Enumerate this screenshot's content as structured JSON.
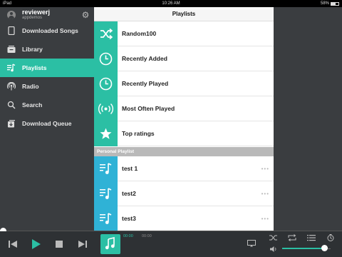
{
  "statusbar": {
    "carrier": "iPad",
    "time": "10:26 AM",
    "battery": "58%",
    "battery_level": 0.58
  },
  "user": {
    "name": "reviewerj",
    "subtitle": "appdemos"
  },
  "nav": {
    "items": [
      {
        "label": "Downloaded Songs",
        "icon": "tablet-icon",
        "active": false
      },
      {
        "label": "Library",
        "icon": "library-icon",
        "active": false
      },
      {
        "label": "Playlists",
        "icon": "playlist-icon",
        "active": true
      },
      {
        "label": "Radio",
        "icon": "radio-icon",
        "active": false
      },
      {
        "label": "Search",
        "icon": "search-icon",
        "active": false
      },
      {
        "label": "Download Queue",
        "icon": "download-queue-icon",
        "active": false
      }
    ]
  },
  "panel": {
    "title": "Playlists",
    "smart_playlists": [
      {
        "label": "Random100",
        "icon": "shuffle-icon"
      },
      {
        "label": "Recently Added",
        "icon": "clock-icon"
      },
      {
        "label": "Recently Played",
        "icon": "clock-icon"
      },
      {
        "label": "Most Often Played",
        "icon": "broadcast-icon"
      },
      {
        "label": "Top ratings",
        "icon": "star-icon"
      }
    ],
    "section_title": "Personal Playlist",
    "personal_playlists": [
      {
        "label": "test 1",
        "more": "•••"
      },
      {
        "label": "test2",
        "more": "•••"
      },
      {
        "label": "test3",
        "more": "•••"
      }
    ]
  },
  "player": {
    "elapsed": "00:00",
    "duration": "00:00",
    "progress": 0,
    "volume": 0.88
  },
  "colors": {
    "accent": "#2bbfa4",
    "accent_blue": "#2fb2d6",
    "sidebar_bg": "#3a3d40"
  }
}
